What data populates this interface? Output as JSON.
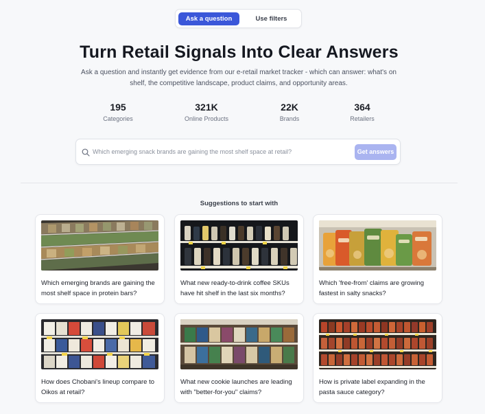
{
  "mode_toggle": {
    "active": "Ask a question",
    "inactive": "Use filters"
  },
  "hero": {
    "title": "Turn Retail Signals Into Clear Answers",
    "subtitle": "Ask a question and instantly get evidence from our e-retail market tracker - which can answer: what's on shelf, the competitive landscape, product claims, and opportunity areas."
  },
  "stats": [
    {
      "value": "195",
      "label": "Categories"
    },
    {
      "value": "321K",
      "label": "Online Products"
    },
    {
      "value": "22K",
      "label": "Brands"
    },
    {
      "value": "364",
      "label": "Retailers"
    }
  ],
  "search": {
    "placeholder": "Which emerging snack brands are gaining the most shelf space at retail?",
    "button_label": "Get answers",
    "icon": "search-icon"
  },
  "suggestions": {
    "heading": "Suggestions to start with",
    "items": [
      {
        "question": "Which emerging brands are gaining the most shelf space in protein bars?",
        "image": "protein-bar-shelf"
      },
      {
        "question": "What new ready-to-drink coffee SKUs have hit shelf in the last six months?",
        "image": "rtd-coffee-cooler"
      },
      {
        "question": "Which 'free-from' claims are growing fastest in salty snacks?",
        "image": "salty-snack-bags"
      },
      {
        "question": "How does Chobani's lineup compare to Oikos at retail?",
        "image": "yogurt-cooler"
      },
      {
        "question": "What new cookie launches are leading with \"better-for-you\" claims?",
        "image": "cookie-shelf"
      },
      {
        "question": "How is private label expanding in the pasta sauce category?",
        "image": "pasta-sauce-shelf"
      }
    ]
  },
  "colors": {
    "accent": "#3b57d9",
    "button_disabled": "#aab4f0",
    "background": "#f7f8fa"
  }
}
